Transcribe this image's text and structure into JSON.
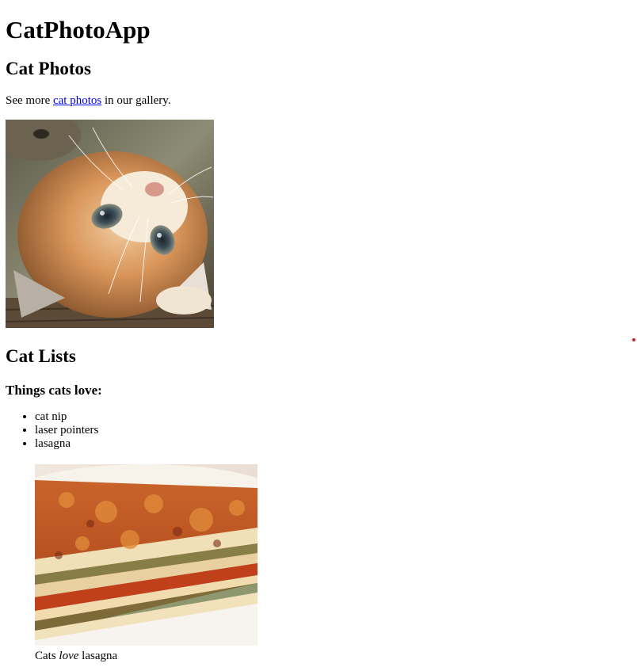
{
  "app_title": "CatPhotoApp",
  "sections": {
    "photos": {
      "heading": "Cat Photos",
      "lead": {
        "before": "See more ",
        "link_text": "cat photos",
        "after": " in our gallery."
      },
      "image_alt": "A cute orange cat lying on its back."
    },
    "lists": {
      "heading": "Cat Lists",
      "subheading": "Things cats love:",
      "items": [
        "cat nip",
        "laser pointers",
        "lasagna"
      ],
      "figure": {
        "image_alt": "A slice of lasagna on a plate.",
        "caption": {
          "before": "Cats ",
          "emphasis": "love",
          "after": " lasagna"
        }
      }
    }
  },
  "colors": {
    "link": "#0000ee",
    "indicator_dot": "#d02020"
  },
  "icons": {
    "indicator": "red-dot-icon"
  }
}
